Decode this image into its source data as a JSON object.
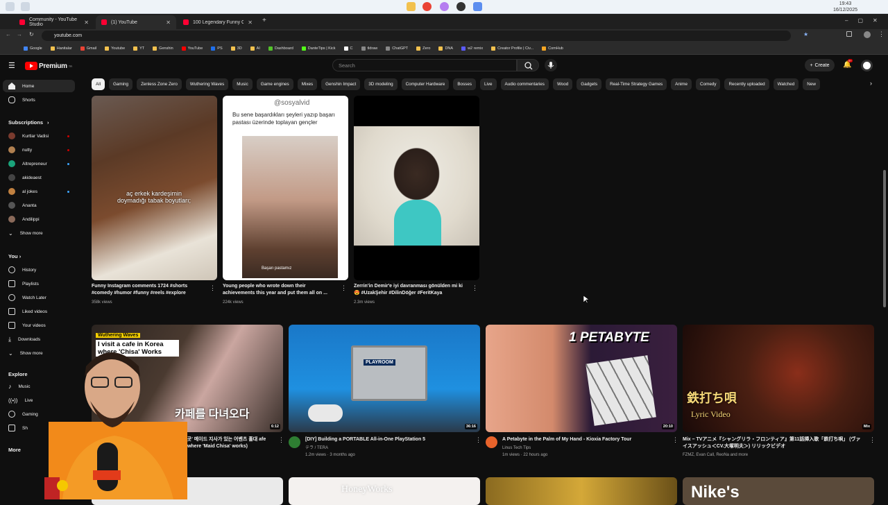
{
  "taskbar": {
    "time": "19:43",
    "date": "16/12/2025"
  },
  "browser": {
    "tabs": [
      {
        "label": "Community - YouTube Studio"
      },
      {
        "label": "(1) YouTube"
      },
      {
        "label": "100 Legendary Funny Commer"
      }
    ],
    "url": "youtube.com",
    "bookmarks": [
      "Google",
      "Hanitalar",
      "Gmail",
      "Youtube",
      "YT",
      "Genshin",
      "YouTube",
      "PS",
      "3D",
      "AI",
      "Dashboard",
      "DanteTips | Kick",
      "C",
      "tldraw",
      "ChatGPT",
      "Zero",
      "DNA",
      "w2 remix",
      "Creator Profile | Civ...",
      "ComHub"
    ]
  },
  "youtube": {
    "logo_text": "Premium",
    "logo_sup": "TR",
    "search_placeholder": "Search",
    "create_label": "Create",
    "notification_count": "9+",
    "chips": [
      "All",
      "Gaming",
      "Zenless Zone Zero",
      "Wuthering Waves",
      "Music",
      "Game engines",
      "Mixes",
      "Genshin Impact",
      "3D modeling",
      "Computer Hardware",
      "Bosses",
      "Live",
      "Audio commentaries",
      "Wood",
      "Gadgets",
      "Real-Time Strategy Games",
      "Anime",
      "Comedy",
      "Recently uploaded",
      "Watched",
      "New"
    ]
  },
  "sidebar": {
    "main": [
      {
        "label": "Home"
      },
      {
        "label": "Shorts"
      }
    ],
    "subscriptions_header": "Subscriptions",
    "subscriptions": [
      {
        "label": "Kurtlar Vadisi"
      },
      {
        "label": "nutty"
      },
      {
        "label": "Altrepreneur"
      },
      {
        "label": "akideaest"
      },
      {
        "label": "al jokes"
      },
      {
        "label": "Ananta"
      },
      {
        "label": "Andilippi"
      }
    ],
    "show_more": "Show more",
    "you_header": "You",
    "you_items": [
      {
        "label": "History"
      },
      {
        "label": "Playlists"
      },
      {
        "label": "Watch Later"
      },
      {
        "label": "Liked videos"
      },
      {
        "label": "Your videos"
      },
      {
        "label": "Downloads"
      },
      {
        "label": "Show more"
      }
    ],
    "explore_header": "Explore",
    "explore_items": [
      {
        "label": "Music"
      },
      {
        "label": "Live"
      },
      {
        "label": "Gaming"
      },
      {
        "label": "Sh"
      }
    ],
    "more_header": "More"
  },
  "shorts": [
    {
      "title": "Funny Instagram comments 1724 #shorts #comedy #humor #funny #reels #explore",
      "views": "358k views",
      "overlay": "aç erkek kardeşimin doymadığı tabak boyutları;"
    },
    {
      "title": "Young people who wrote down their achievements this year and put them all on ...",
      "views": "224k views",
      "overlay": "Bu sene başardıkları şeyleri yazıp başarı pastası üzerinde toplayan gençler",
      "handle": "@sosyalvid",
      "caption": "Başarı pastamız"
    },
    {
      "title": "Zerrin'in Demir'e iyi davranması gönülden mi ki 😍 #UzakŞehir #DilinDöğer #FeritKaya",
      "views": "2.3m views"
    }
  ],
  "videos": [
    {
      "title": "주 머무는 곳' 메이드 지사가 있는 어벤츠 홀대 afe in Korea where 'Maid Chisa' works)",
      "meta1": "",
      "meta2": "",
      "duration": "6:12",
      "thumb_text": "I visit a cafe in Korea where 'Chisa' Works",
      "thumb_tag": "Wuthering Waves",
      "thumb_kr": "카페를 다녀오다"
    },
    {
      "title": "[DIY] Building a PORTABLE All-in-One PlayStation 5",
      "meta1": "テラ / TERA",
      "meta2": "1.2m views · 3 months ago",
      "duration": "36:16",
      "thumb_text": "PLAYROOM"
    },
    {
      "title": "A Petabyte in the Palm of My Hand - Kioxia Factory Tour",
      "meta1": "Linus Tech Tips",
      "meta2": "1m views · 22 hours ago",
      "duration": "20:10",
      "thumb_text": "1 PETABYTE"
    },
    {
      "title": "Mix – TVアニメ『シャングリラ・フロンティア』第11話挿入歌「鉄打ち唄」 (ヴァイスアッシュ＜CV.大塚明夫＞) リリックビデオ",
      "meta1": "FZMZ, Evan Call, ReoNa and more",
      "meta2": "",
      "duration": "Mix",
      "thumb_text": "鉄打ち唄",
      "thumb_sub": "Lyric Video"
    }
  ],
  "bottom_row": [
    {
      "thumb_text": "HoneyWorks"
    },
    {
      "thumb_text": "Nike's"
    }
  ]
}
